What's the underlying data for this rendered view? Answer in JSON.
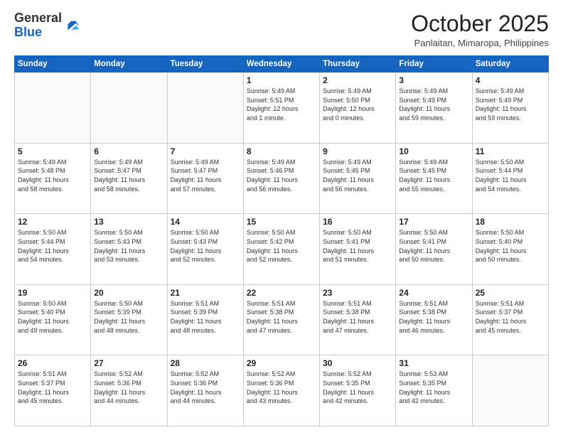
{
  "logo": {
    "general": "General",
    "blue": "Blue"
  },
  "header": {
    "month": "October 2025",
    "location": "Panlaitan, Mimaropa, Philippines"
  },
  "weekdays": [
    "Sunday",
    "Monday",
    "Tuesday",
    "Wednesday",
    "Thursday",
    "Friday",
    "Saturday"
  ],
  "weeks": [
    [
      {
        "day": "",
        "info": ""
      },
      {
        "day": "",
        "info": ""
      },
      {
        "day": "",
        "info": ""
      },
      {
        "day": "1",
        "info": "Sunrise: 5:49 AM\nSunset: 5:51 PM\nDaylight: 12 hours\nand 1 minute."
      },
      {
        "day": "2",
        "info": "Sunrise: 5:49 AM\nSunset: 5:50 PM\nDaylight: 12 hours\nand 0 minutes."
      },
      {
        "day": "3",
        "info": "Sunrise: 5:49 AM\nSunset: 5:49 PM\nDaylight: 11 hours\nand 59 minutes."
      },
      {
        "day": "4",
        "info": "Sunrise: 5:49 AM\nSunset: 5:49 PM\nDaylight: 11 hours\nand 59 minutes."
      }
    ],
    [
      {
        "day": "5",
        "info": "Sunrise: 5:49 AM\nSunset: 5:48 PM\nDaylight: 11 hours\nand 58 minutes."
      },
      {
        "day": "6",
        "info": "Sunrise: 5:49 AM\nSunset: 5:47 PM\nDaylight: 11 hours\nand 58 minutes."
      },
      {
        "day": "7",
        "info": "Sunrise: 5:49 AM\nSunset: 5:47 PM\nDaylight: 11 hours\nand 57 minutes."
      },
      {
        "day": "8",
        "info": "Sunrise: 5:49 AM\nSunset: 5:46 PM\nDaylight: 11 hours\nand 56 minutes."
      },
      {
        "day": "9",
        "info": "Sunrise: 5:49 AM\nSunset: 5:45 PM\nDaylight: 11 hours\nand 56 minutes."
      },
      {
        "day": "10",
        "info": "Sunrise: 5:49 AM\nSunset: 5:45 PM\nDaylight: 11 hours\nand 55 minutes."
      },
      {
        "day": "11",
        "info": "Sunrise: 5:50 AM\nSunset: 5:44 PM\nDaylight: 11 hours\nand 54 minutes."
      }
    ],
    [
      {
        "day": "12",
        "info": "Sunrise: 5:50 AM\nSunset: 5:44 PM\nDaylight: 11 hours\nand 54 minutes."
      },
      {
        "day": "13",
        "info": "Sunrise: 5:50 AM\nSunset: 5:43 PM\nDaylight: 11 hours\nand 53 minutes."
      },
      {
        "day": "14",
        "info": "Sunrise: 5:50 AM\nSunset: 5:43 PM\nDaylight: 11 hours\nand 52 minutes."
      },
      {
        "day": "15",
        "info": "Sunrise: 5:50 AM\nSunset: 5:42 PM\nDaylight: 11 hours\nand 52 minutes."
      },
      {
        "day": "16",
        "info": "Sunrise: 5:50 AM\nSunset: 5:41 PM\nDaylight: 11 hours\nand 51 minutes."
      },
      {
        "day": "17",
        "info": "Sunrise: 5:50 AM\nSunset: 5:41 PM\nDaylight: 11 hours\nand 50 minutes."
      },
      {
        "day": "18",
        "info": "Sunrise: 5:50 AM\nSunset: 5:40 PM\nDaylight: 11 hours\nand 50 minutes."
      }
    ],
    [
      {
        "day": "19",
        "info": "Sunrise: 5:50 AM\nSunset: 5:40 PM\nDaylight: 11 hours\nand 49 minutes."
      },
      {
        "day": "20",
        "info": "Sunrise: 5:50 AM\nSunset: 5:39 PM\nDaylight: 11 hours\nand 48 minutes."
      },
      {
        "day": "21",
        "info": "Sunrise: 5:51 AM\nSunset: 5:39 PM\nDaylight: 11 hours\nand 48 minutes."
      },
      {
        "day": "22",
        "info": "Sunrise: 5:51 AM\nSunset: 5:38 PM\nDaylight: 11 hours\nand 47 minutes."
      },
      {
        "day": "23",
        "info": "Sunrise: 5:51 AM\nSunset: 5:38 PM\nDaylight: 11 hours\nand 47 minutes."
      },
      {
        "day": "24",
        "info": "Sunrise: 5:51 AM\nSunset: 5:38 PM\nDaylight: 11 hours\nand 46 minutes."
      },
      {
        "day": "25",
        "info": "Sunrise: 5:51 AM\nSunset: 5:37 PM\nDaylight: 11 hours\nand 45 minutes."
      }
    ],
    [
      {
        "day": "26",
        "info": "Sunrise: 5:51 AM\nSunset: 5:37 PM\nDaylight: 11 hours\nand 45 minutes."
      },
      {
        "day": "27",
        "info": "Sunrise: 5:52 AM\nSunset: 5:36 PM\nDaylight: 11 hours\nand 44 minutes."
      },
      {
        "day": "28",
        "info": "Sunrise: 5:52 AM\nSunset: 5:36 PM\nDaylight: 11 hours\nand 44 minutes."
      },
      {
        "day": "29",
        "info": "Sunrise: 5:52 AM\nSunset: 5:36 PM\nDaylight: 11 hours\nand 43 minutes."
      },
      {
        "day": "30",
        "info": "Sunrise: 5:52 AM\nSunset: 5:35 PM\nDaylight: 11 hours\nand 42 minutes."
      },
      {
        "day": "31",
        "info": "Sunrise: 5:53 AM\nSunset: 5:35 PM\nDaylight: 11 hours\nand 42 minutes."
      },
      {
        "day": "",
        "info": ""
      }
    ]
  ]
}
